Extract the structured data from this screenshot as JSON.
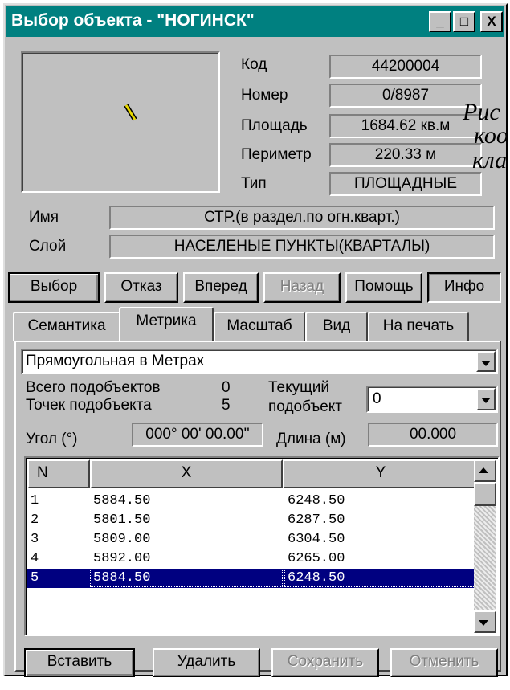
{
  "window": {
    "title": "Выбор объекта - \"НОГИНСК\""
  },
  "titlebar_buttons": [
    "_",
    "□",
    "X"
  ],
  "properties": {
    "kod": {
      "label": "Код",
      "value": "44200004"
    },
    "nomer": {
      "label": "Номер",
      "value": "0/8987"
    },
    "ploshad": {
      "label": "Площадь",
      "value": "1684.62  кв.м"
    },
    "perimetr": {
      "label": "Периметр",
      "value": "220.33  м"
    },
    "tip": {
      "label": "Тип",
      "value": "ПЛОЩАДНЫЕ"
    },
    "imya": {
      "label": "Имя",
      "value": "СТР.(в раздел.по огн.кварт.)"
    },
    "sloy": {
      "label": "Слой",
      "value": "НАСЕЛЕНЫЕ ПУНКТЫ(КВАРТАЛЫ)"
    }
  },
  "background_text": [
    "Рис",
    "коо",
    "кла"
  ],
  "actions": [
    "Выбор",
    "Отказ",
    "Вперед",
    "Назад",
    "Помощь",
    "Инфо"
  ],
  "tabs": [
    "Семантика",
    "Метрика",
    "Масштаб",
    "Вид",
    "На печать"
  ],
  "active_tab": "Метрика",
  "metrika": {
    "projection": "Прямоугольная в Метрах",
    "total_subobjects_label": "Всего подобъектов",
    "total_subobjects": "0",
    "points_label": "Точек подобъекта",
    "points": "5",
    "current_label_1": "Текущий",
    "current_label_2": "подобъект",
    "current_value": "0",
    "angle_label": "Угол (°)",
    "angle_value": "000° 00' 00.00''",
    "length_label": "Длина (м)",
    "length_value": "00.000"
  },
  "grid": {
    "columns": [
      "N",
      "X",
      "Y"
    ],
    "rows": [
      {
        "n": "1",
        "x": "5884.50",
        "y": "6248.50"
      },
      {
        "n": "2",
        "x": "5801.50",
        "y": "6287.50"
      },
      {
        "n": "3",
        "x": "5809.00",
        "y": "6304.50"
      },
      {
        "n": "4",
        "x": "5892.00",
        "y": "6265.00"
      },
      {
        "n": "5",
        "x": "5884.50",
        "y": "6248.50"
      }
    ],
    "selected_row": 5
  },
  "bottom_buttons": [
    "Вставить",
    "Удалить",
    "Сохранить",
    "Отменить"
  ],
  "colors": {
    "titlebar": "#008080",
    "selection": "#000080",
    "face": "#c0c0c0"
  }
}
